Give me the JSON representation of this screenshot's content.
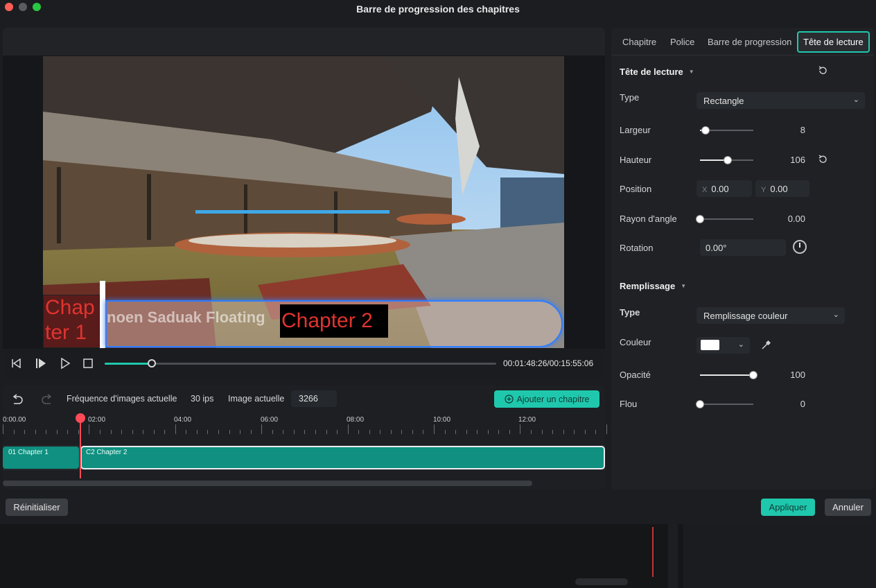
{
  "window": {
    "title": "Barre de progression des chapitres"
  },
  "player": {
    "overlay_chapter1": "Chap ter 1",
    "overlay_title_text": "noen Saduak Floating",
    "overlay_chapter2": "Chapter 2",
    "progress": 0.12,
    "timecode": "00:01:48:26/00:15:55:06"
  },
  "timeline": {
    "fps_label": "Fréquence d'images actuelle",
    "fps_value": "30 ips",
    "frame_label": "Image actuelle",
    "frame_value": "3266",
    "add_chapter_label": "Ajouter un chapitre",
    "ruler": [
      "0:00.00",
      "02:00",
      "04:00",
      "06:00",
      "08:00",
      "10:00",
      "12:00"
    ],
    "clips": [
      {
        "label": "01 Chapter 1"
      },
      {
        "label": "C2 Chapter 2"
      }
    ]
  },
  "tabs": [
    "Chapitre",
    "Police",
    "Barre de progression",
    "Tête de lecture"
  ],
  "playhead_section": {
    "title": "Tête de lecture",
    "type_label": "Type",
    "type_value": "Rectangle",
    "width_label": "Largeur",
    "width_value": "8",
    "width_level": 0.1,
    "height_label": "Hauteur",
    "height_value": "106",
    "height_level": 0.52,
    "position_label": "Position",
    "pos_x_axis": "X",
    "pos_x": "0.00",
    "pos_y_axis": "Y",
    "pos_y": "0.00",
    "radius_label": "Rayon d'angle",
    "radius_value": "0.00",
    "radius_level": 0.0,
    "rotation_label": "Rotation",
    "rotation_value": "0.00°"
  },
  "fill_section": {
    "title": "Remplissage",
    "type_label": "Type",
    "type_value": "Remplissage couleur",
    "color_label": "Couleur",
    "color_value": "#ffffff",
    "opacity_label": "Opacité",
    "opacity_value": "100",
    "opacity_level": 1.0,
    "blur_label": "Flou",
    "blur_value": "0",
    "blur_level": 0.0
  },
  "footer": {
    "reset_label": "Réinitialiser",
    "apply_label": "Appliquer",
    "cancel_label": "Annuler"
  },
  "colors": {
    "accent": "#1fc8ad",
    "playhead": "#ff4a57"
  }
}
